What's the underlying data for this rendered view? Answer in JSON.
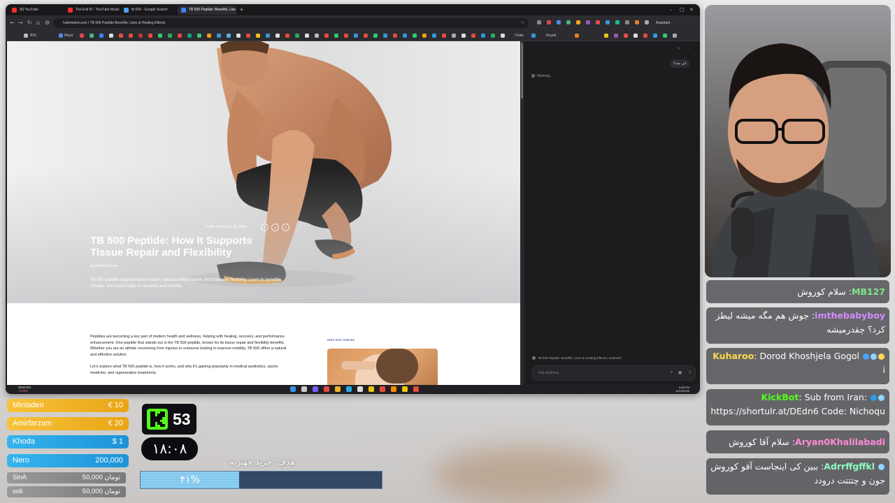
{
  "browser": {
    "tabs": [
      {
        "title": "(8) YouTube",
        "color": "#ff2a2a"
      },
      {
        "title": "The Evil ID - YouTube Music",
        "color": "#ff2a2a"
      },
      {
        "title": "tb 500 - Google Search",
        "color": "#4aa3ff"
      },
      {
        "title": "TB 500 Peptide: Benefits, Use",
        "color": "#3b82f6"
      }
    ],
    "new_tab": "+",
    "address": "hubmeded.com / TB 500 Peptide Benefits, Uses & Healing Effects",
    "assistant_label": "Assistant",
    "bookmarks": {
      "first": "AOL",
      "second": "Maya",
      "chats": "Chats",
      "keyed": "Keyed"
    }
  },
  "article": {
    "meta": "4 min. read  |  July 31, 2025",
    "social": [
      "f",
      "in",
      "x"
    ],
    "title": "TB 500 Peptide: How It Supports Tissue Repair and Flexibility",
    "byline": "by Hubmed Team",
    "excerpt": "TB 500 peptide supports tissue repair, reduces inflammation, and improves flexibility. Learn its benefits, dosage, and how it helps in recovery and mobility.",
    "paragraph1": "Peptides are becoming a key part of modern health and wellness, helping with healing, recovery, and performance enhancement. One peptide that stands out is the TB 500 peptide, known for its tissue repair and flexibility benefits. Whether you are an athlete recovering from injuries or someone looking to improve mobility, TB 500 offers a natural and effective solution.",
    "paragraph2": "Let's explore what TB 500 peptide is, how it works, and why it's gaining popularity in medical aesthetics, sports medicine, and regenerative treatments.",
    "more_from": "More from Hubmed"
  },
  "assistant_panel": {
    "user_message": "این چیه؟",
    "status": "Working...",
    "context_tab": "TB 500 Peptide: Benefits, Uses & Healing Effects | Hubmed",
    "ask_placeholder": "Ask anything..."
  },
  "taskbar": {
    "weather_line1": "Watchlist",
    "weather_line2": "-0.62%",
    "time": "6:08 PM",
    "date": "12/15/2025"
  },
  "chat": [
    {
      "user": "MB127",
      "color": "#7ee787",
      "text": "سلام کوروش"
    },
    {
      "user": "imthebabyboy",
      "color": "#d48cff",
      "text": "جوش هم مگه میشه لیطز کرد؟ چقدرمیشه"
    },
    {
      "user": "Kuharoo",
      "color": "#ffd84a",
      "text": "Dorod Khoshjela Gogol i"
    },
    {
      "user": "KickBot",
      "color": "#53fc18",
      "text": "Sub from Iran: https://shortulr.at/DEdn6 Code: Nichoqu"
    },
    {
      "user": "Aryan0Khalilabadi",
      "color": "#ff8ad6",
      "text": "سلام آقا کوروش"
    },
    {
      "user": "Adrrffgffkl",
      "color": "#8affc1",
      "text": "ببین کی اینجاست آقو کوروش جون و چتتتت درودد"
    }
  ],
  "donations": [
    {
      "name": "Minladen",
      "value": "€ 10",
      "color": "#f2b321"
    },
    {
      "name": "Amirfarzam",
      "value": "€ 20",
      "color": "#f2b321"
    },
    {
      "name": "Khoda",
      "value": "$ 1",
      "color": "#29a8e8"
    },
    {
      "name": "Nero",
      "value": "200,000",
      "color": "#29a8e8"
    },
    {
      "name": "SinA",
      "value": "50,000 تومان",
      "color": "#8a8a8a"
    },
    {
      "name": "soli",
      "value": "50,000 تومان",
      "color": "#8a8a8a"
    }
  ],
  "kick": {
    "count": "53"
  },
  "timer": "۱۸:۰۸",
  "goal": {
    "label": "هدف: خرید جهیزیه",
    "percent_text": "۴۱%",
    "percent": 41
  }
}
